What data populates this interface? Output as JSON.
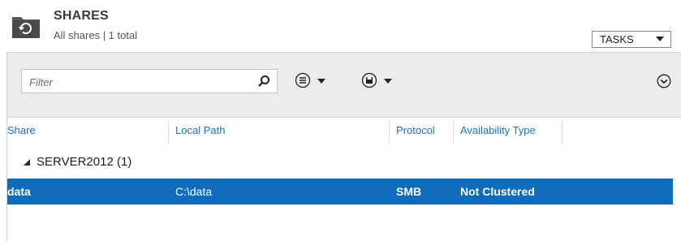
{
  "header": {
    "title": "SHARES",
    "subtitle": "All shares | 1 total",
    "tasks_label": "TASKS"
  },
  "toolbar": {
    "filter_placeholder": "Filter",
    "icons": [
      "search-icon",
      "list-view-icon",
      "save-icon",
      "expand-icon"
    ]
  },
  "table": {
    "columns": [
      "Share",
      "Local Path",
      "Protocol",
      "Availability Type"
    ],
    "groups": [
      {
        "label": "SERVER2012 (1)",
        "rows": [
          {
            "share": "data",
            "local_path": "C:\\data",
            "protocol": "SMB",
            "availability_type": "Not Clustered",
            "selected": true
          }
        ]
      }
    ]
  },
  "colors": {
    "accent": "#1874c5",
    "selection": "#0f6cbd",
    "toolbar_bg": "#ececec"
  }
}
